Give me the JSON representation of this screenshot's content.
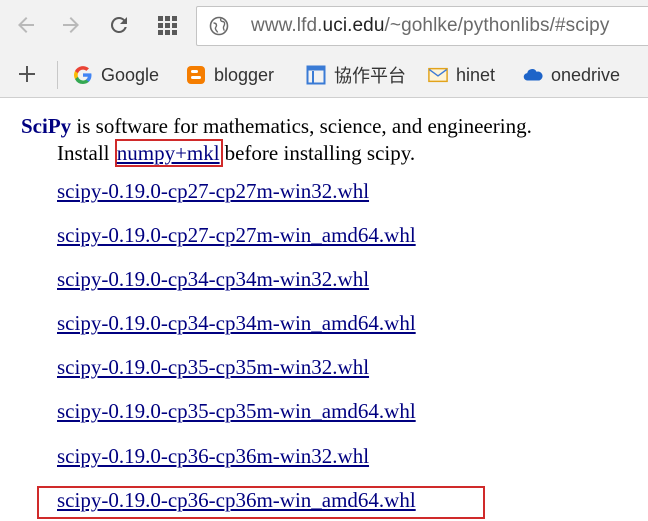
{
  "browser": {
    "url_prefix": "www.lfd.",
    "url_host": "uci.edu",
    "url_suffix": "/~gohlke/pythonlibs/#scipy",
    "icons": {
      "back": "arrow-left-icon",
      "forward": "arrow-right-icon",
      "reload": "reload-icon",
      "apps": "apps-grid-icon",
      "site_info": "site-info-icon"
    }
  },
  "bookmarks": {
    "add_icon": "plus-icon",
    "items": [
      {
        "label": "Google",
        "icon": "google-icon"
      },
      {
        "label": "blogger",
        "icon": "blogger-icon"
      },
      {
        "label": "協作平台",
        "icon": "sites-icon"
      },
      {
        "label": "hinet",
        "icon": "mail-icon"
      },
      {
        "label": "onedrive",
        "icon": "cloud-icon"
      }
    ]
  },
  "page": {
    "brand": "SciPy",
    "intro_rest": " is software for mathematics, science, and engineering.",
    "install_prefix": "Install ",
    "prerequisite_link": "numpy+mkl",
    "install_suffix": "before installing scipy.",
    "links": [
      "scipy-0.19.0-cp27-cp27m-win32.whl",
      "scipy-0.19.0-cp27-cp27m-win_amd64.whl",
      "scipy-0.19.0-cp34-cp34m-win32.whl",
      "scipy-0.19.0-cp34-cp34m-win_amd64.whl",
      "scipy-0.19.0-cp35-cp35m-win32.whl",
      "scipy-0.19.0-cp35-cp35m-win_amd64.whl",
      "scipy-0.19.0-cp36-cp36m-win32.whl",
      "scipy-0.19.0-cp36-cp36m-win_amd64.whl"
    ],
    "colors": {
      "link": "#000080",
      "highlight_border": "#d02a2a"
    }
  }
}
